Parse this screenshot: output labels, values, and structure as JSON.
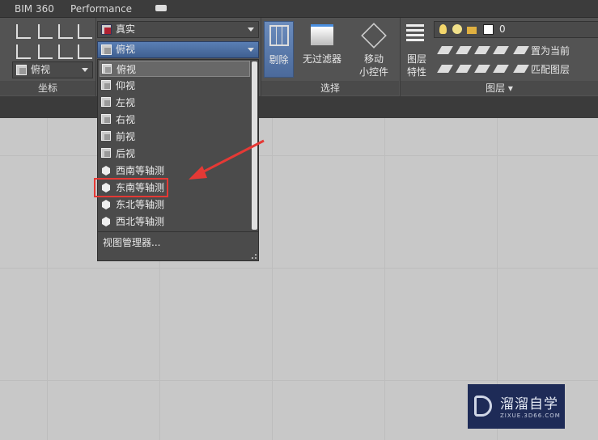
{
  "topbar": {
    "tabs": [
      "BIM 360",
      "Performance"
    ]
  },
  "ribbon": {
    "coords_panel": {
      "label": "坐标",
      "view_combo": "俯视"
    },
    "visual_style_combo": "真实",
    "view_combo": "俯视",
    "select_panel": {
      "label": "选择",
      "cull": "剔除",
      "no_filter": "无过滤器",
      "move_gizmo_1": "移动",
      "move_gizmo_2": "小控件"
    },
    "layers_panel": {
      "label": "图层",
      "layer_props_1": "图层",
      "layer_props_2": "特性",
      "layer_combo": "0",
      "set_current": "置为当前",
      "match_layer": "匹配图层"
    }
  },
  "dropdown": {
    "items": [
      "俯视",
      "仰视",
      "左视",
      "右视",
      "前视",
      "后视",
      "西南等轴测",
      "东南等轴测",
      "东北等轴测",
      "西北等轴测"
    ],
    "selected": "俯视",
    "highlighted": "东南等轴测",
    "manager": "视图管理器..."
  },
  "watermark": {
    "name": "溜溜自学",
    "url": "ZIXUE.3D66.COM"
  },
  "colors": {
    "highlight_box": "#e53935",
    "arrow": "#e53935",
    "active_combo": "#4a6a9a",
    "watermark_bg": "#1e2b57"
  }
}
